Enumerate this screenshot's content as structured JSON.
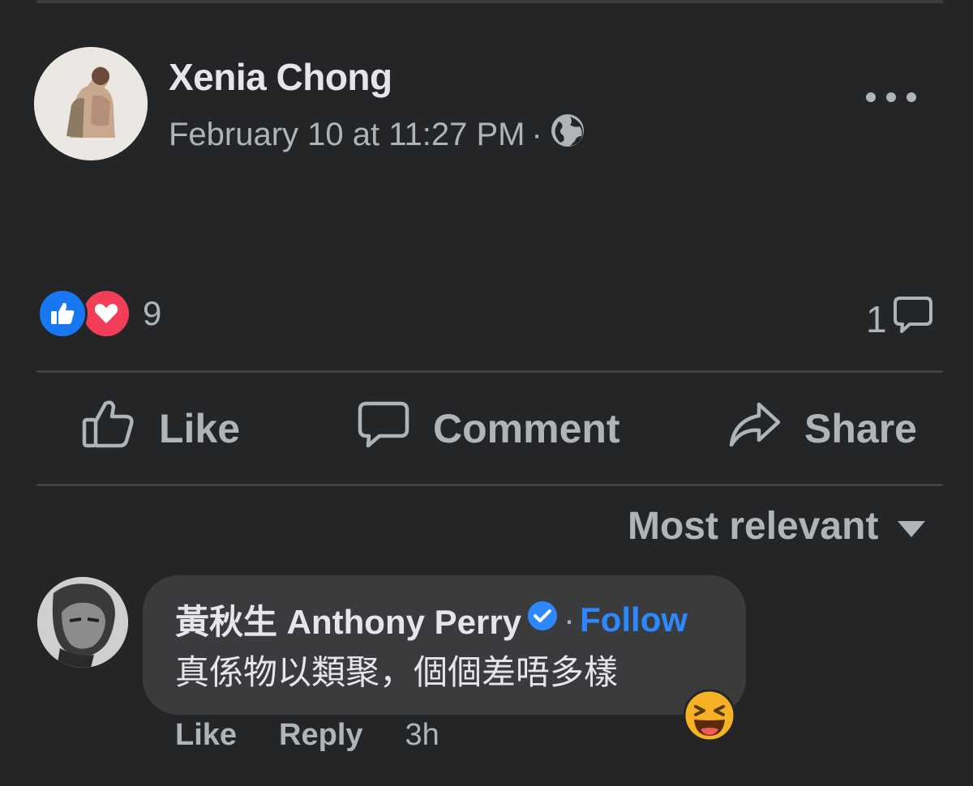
{
  "post": {
    "author": "Xenia Chong",
    "timestamp": "February 10 at 11:27 PM",
    "separator": "·",
    "privacy_icon": "globe-icon",
    "more_icon": "more-horizontal-icon"
  },
  "stats": {
    "reaction_icons": [
      "like-reaction-icon",
      "love-reaction-icon"
    ],
    "reaction_count": "9",
    "comment_count": "1"
  },
  "actions": {
    "like": "Like",
    "comment": "Comment",
    "share": "Share"
  },
  "sort": {
    "label": "Most relevant",
    "icon": "caret-down-icon"
  },
  "comments": [
    {
      "author": "黃秋生 Anthony Perry",
      "verified": true,
      "separator": "·",
      "follow_label": "Follow",
      "text": "真係物以類聚，個個差唔多樣",
      "reaction_icon": "laughing-emoji-icon",
      "like_label": "Like",
      "reply_label": "Reply",
      "time": "3h"
    }
  ],
  "colors": {
    "background": "#242526",
    "bubble": "#3a3b3c",
    "primary_text": "#e4e6eb",
    "secondary_text": "#b0b3b8",
    "link_blue": "#2d88ff",
    "like_blue": "#1877f2",
    "love_red": "#f33e58"
  }
}
